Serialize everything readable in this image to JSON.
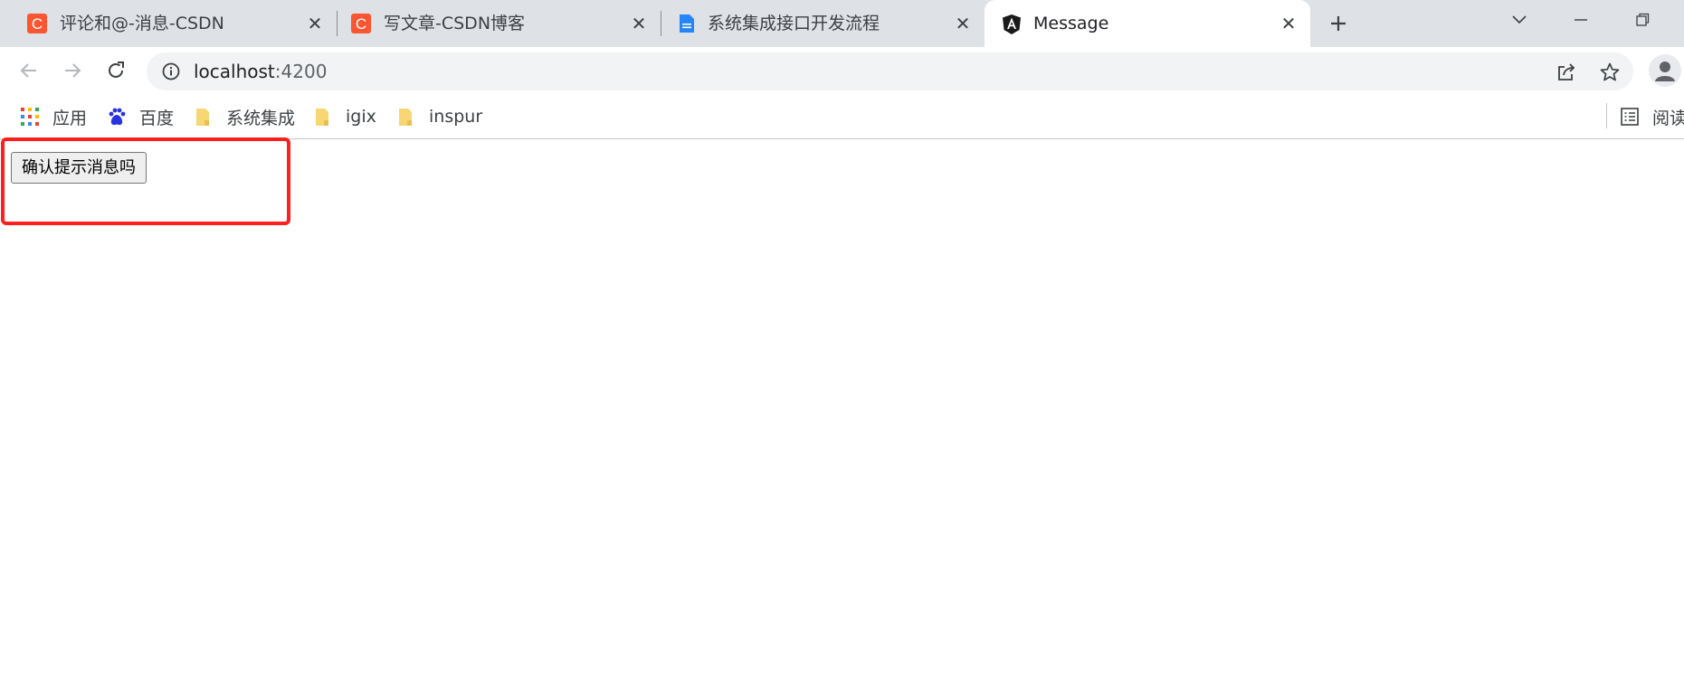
{
  "browser": {
    "tabs": [
      {
        "title": "评论和@-消息-CSDN",
        "icon": "csdn-icon",
        "active": false
      },
      {
        "title": "写文章-CSDN博客",
        "icon": "csdn-icon",
        "active": false
      },
      {
        "title": "系统集成接口开发流程",
        "icon": "docs-icon",
        "active": false
      },
      {
        "title": "Message",
        "icon": "angular-icon",
        "active": true
      }
    ],
    "close_glyph": "✕",
    "address": {
      "host": "localhost",
      "port": ":4200"
    },
    "bookmarks": [
      {
        "label": "应用",
        "icon": "apps-grid-icon"
      },
      {
        "label": "百度",
        "icon": "baidu-icon"
      },
      {
        "label": "系统集成",
        "icon": "folder-icon"
      },
      {
        "label": "igix",
        "icon": "folder-icon"
      },
      {
        "label": "inspur",
        "icon": "folder-icon"
      }
    ],
    "reading_list_label": "阅读",
    "colors": {
      "tabstrip": "#dee1e6",
      "omnibox": "#f1f3f4",
      "csdn": "#fc5531",
      "highlight": "#ff1f1f"
    }
  },
  "page": {
    "confirm_button_label": "确认提示消息吗"
  }
}
